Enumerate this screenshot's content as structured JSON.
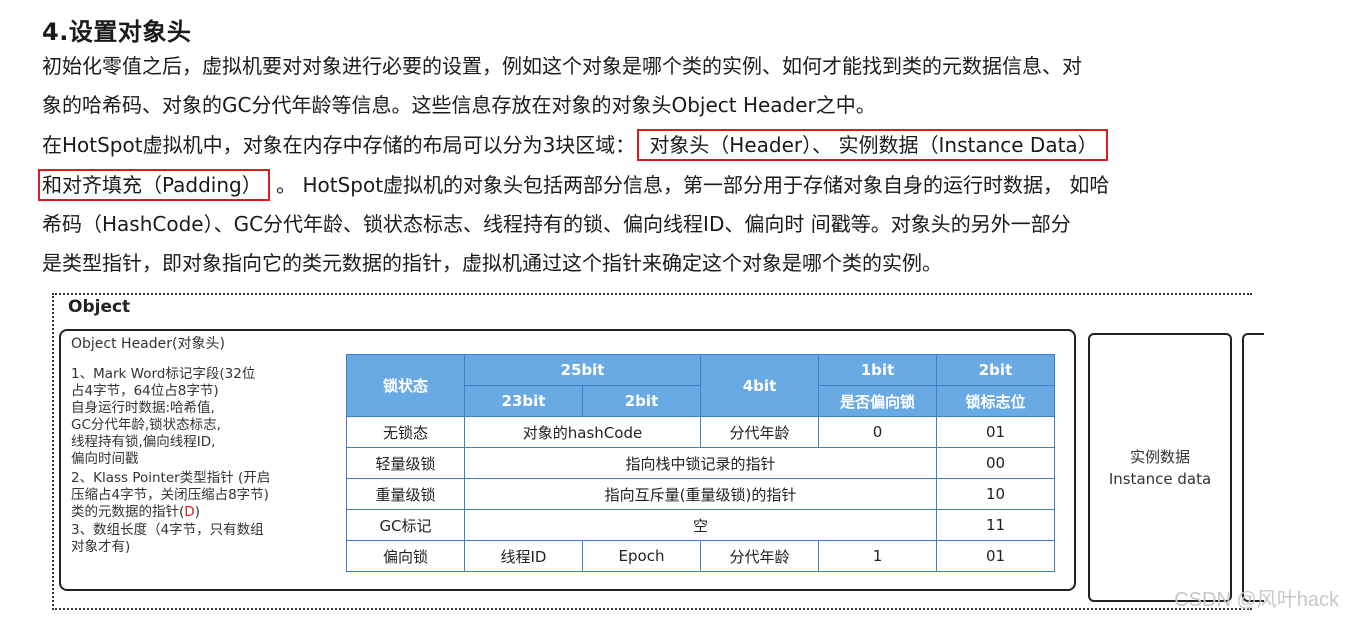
{
  "title": "4.设置对象头",
  "paragraph": {
    "line1": "初始化零值之后，虚拟机要对对象进行必要的设置，例如这个对象是哪个类的实例、如何才能找到类的元数据信息、对",
    "line2": "象的哈希码、对象的GC分代年龄等信息。这些信息存放在对象的对象头Object Header之中。",
    "line3_prefix": "在HotSpot虚拟机中，对象在内存中存储的布局可以分为3块区域：",
    "line3_boxed": "对象头（Header）、 实例数据（Instance Data）",
    "line4_boxed": "和对齐填充（Padding）",
    "line4_suffix": " 。 HotSpot虚拟机的对象头包括两部分信息，第一部分用于存储对象自身的运行时数据， 如哈",
    "line5": "希码（HashCode）、GC分代年龄、锁状态标志、线程持有的锁、偏向线程ID、偏向时 间戳等。对象头的另外一部分",
    "line6": "是类型指针，即对象指向它的类元数据的指针，虚拟机通过这个指针来确定这个对象是哪个类的实例。"
  },
  "diagram": {
    "object_label": "Object",
    "header_title": "Object Header(对象头)",
    "desc": [
      "1、Mark Word标记字段(32位",
      " 占4字节，64位占8字节)",
      "自身运行时数据:哈希值,",
      "GC分代年龄,锁状态标志,",
      "线程持有锁,偏向线程ID,",
      "偏向时间戳",
      "2、Klass Pointer类型指针 (开启",
      "压缩占4字节，关闭压缩占8字节)"
    ],
    "desc_class_ptr_prefix": "类的元数据的指针(",
    "desc_class_ptr_red": "D",
    "desc_class_ptr_suffix": ")",
    "desc_tail": [
      "3、数组长度（4字节，只有数组",
      "对象才有)"
    ],
    "table": {
      "h_lock_state": "锁状态",
      "h_25bit": "25bit",
      "h_4bit": "4bit",
      "h_1bit": "1bit",
      "h_2bit": "2bit",
      "h_23bit": "23bit",
      "h_2bit_sub": "2bit",
      "h_biased": "是否偏向锁",
      "h_flag": "锁标志位",
      "rows": {
        "unlocked": {
          "state": "无锁态",
          "hash": "对象的hashCode",
          "age": "分代年龄",
          "biased": "0",
          "flag": "01"
        },
        "light": {
          "state": "轻量级锁",
          "content": "指向栈中锁记录的指针",
          "flag": "00"
        },
        "heavy": {
          "state": "重量级锁",
          "content": "指向互斥量(重量级锁)的指针",
          "flag": "10"
        },
        "gc": {
          "state": "GC标记",
          "content": "空",
          "flag": "11"
        },
        "biased": {
          "state": "偏向锁",
          "thread": "线程ID",
          "epoch": "Epoch",
          "age": "分代年龄",
          "biased": "1",
          "flag": "01"
        }
      }
    },
    "instance_line1": "实例数据",
    "instance_line2": "Instance data"
  },
  "watermark": "CSDN @风叶hack"
}
